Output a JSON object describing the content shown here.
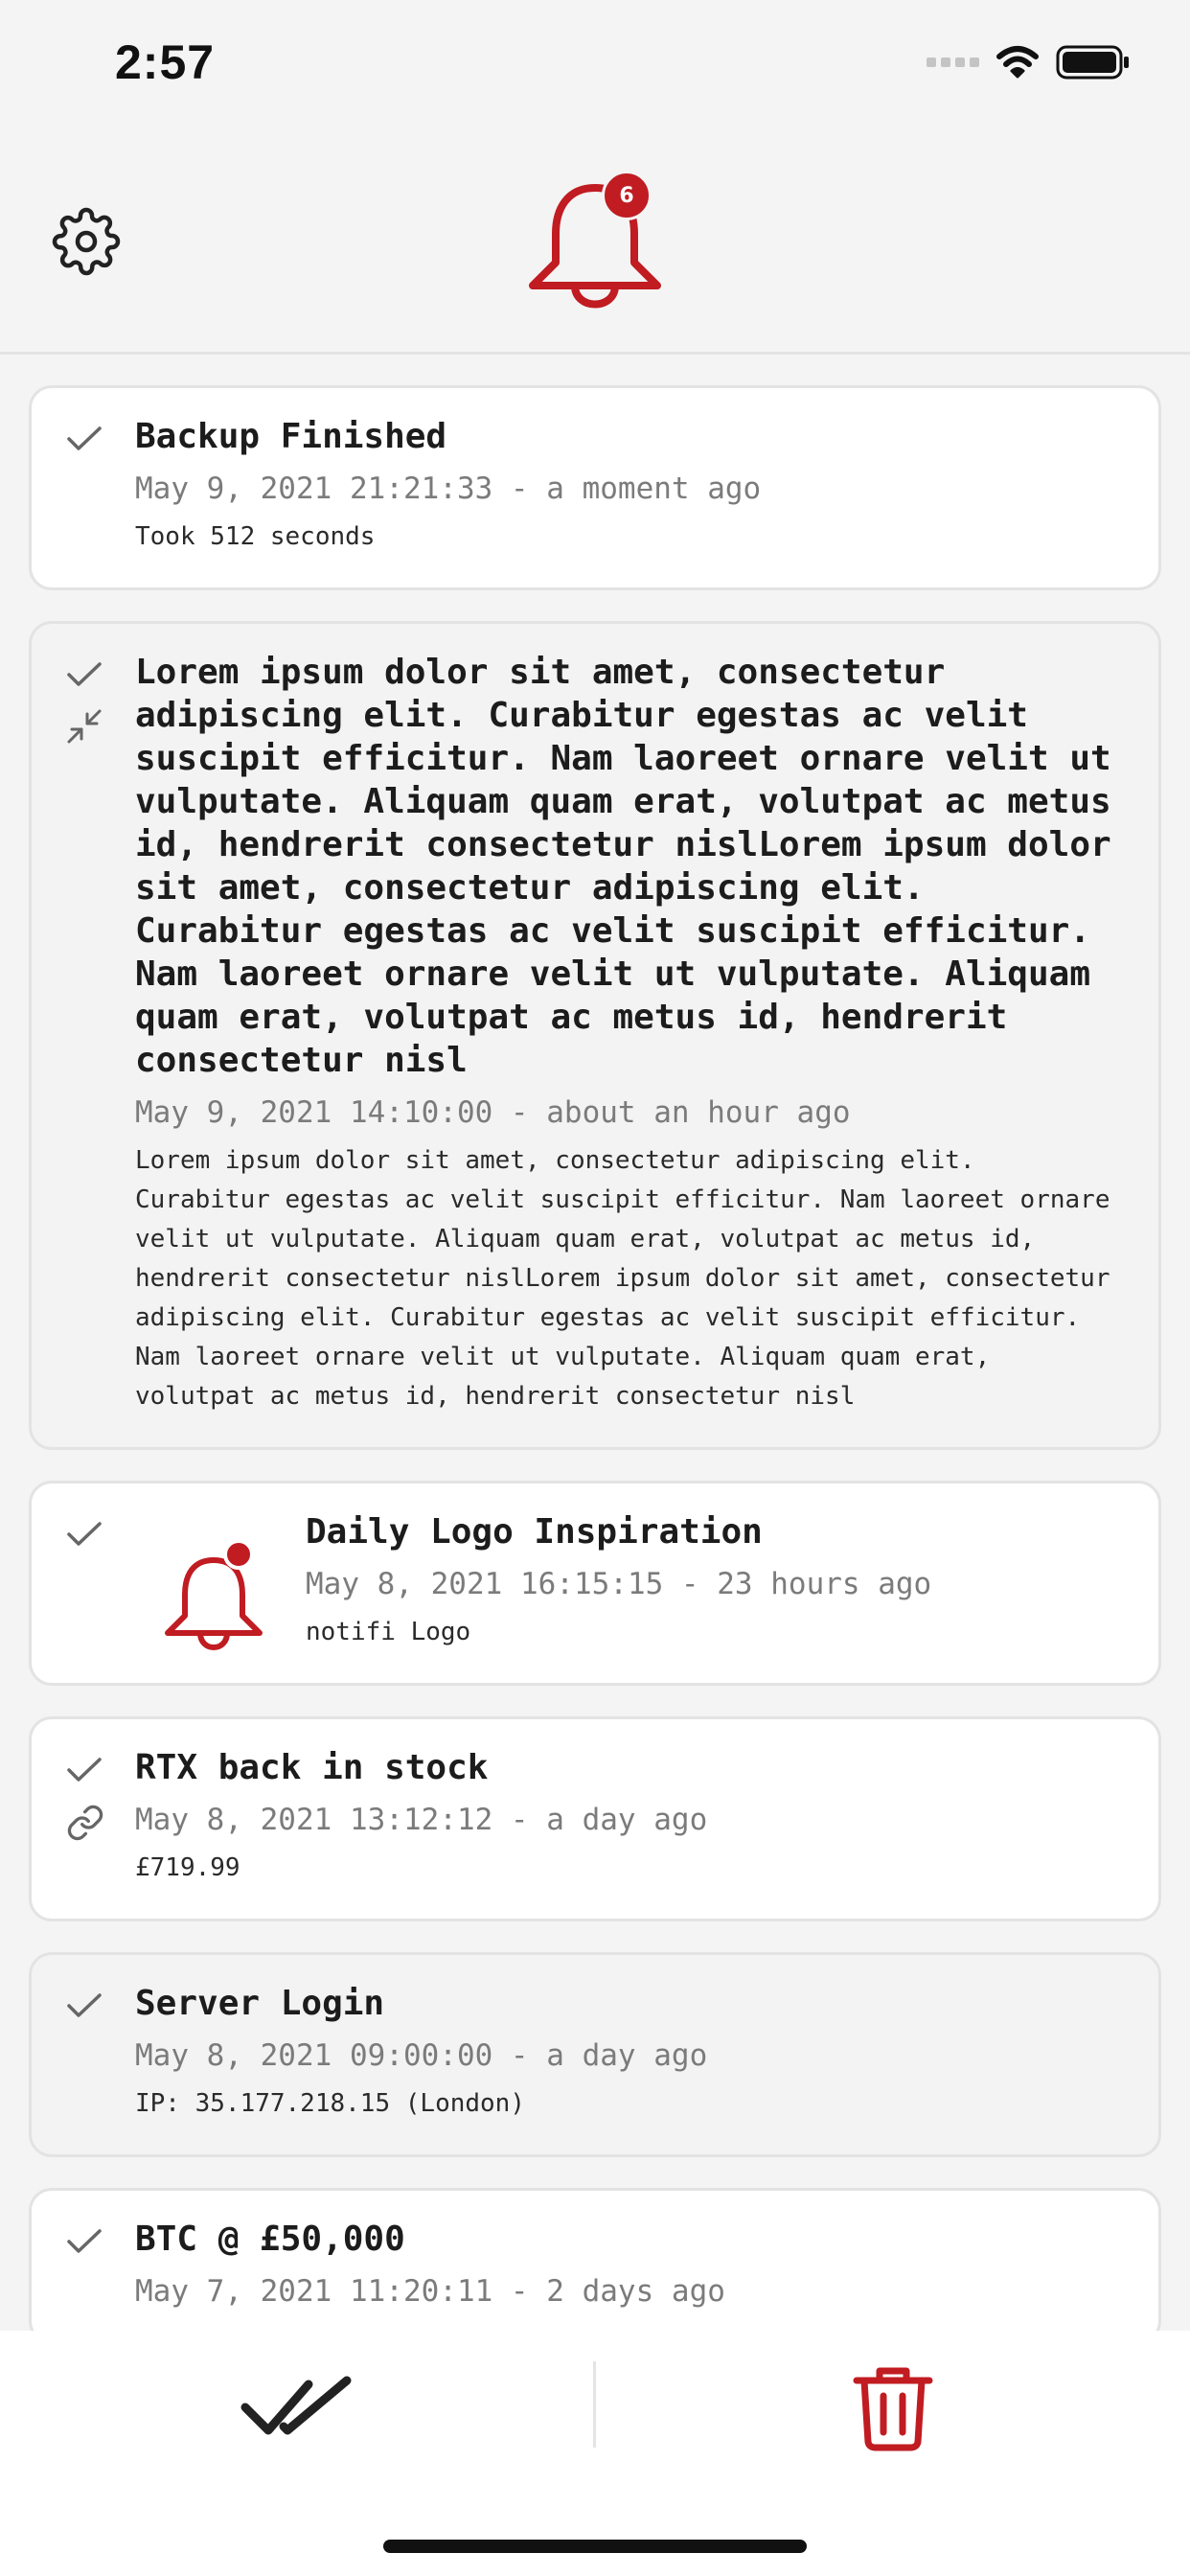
{
  "status_bar": {
    "time": "2:57"
  },
  "header": {
    "badge_count": "6",
    "accent_color": "#c01c22"
  },
  "notifications": [
    {
      "title": "Backup Finished",
      "meta": "May 9, 2021 21:21:33 - a moment ago",
      "body": "Took 512 seconds",
      "read": true
    },
    {
      "title": "Lorem ipsum dolor sit amet, consectetur adipiscing elit. Curabitur egestas ac velit suscipit efficitur. Nam laoreet ornare velit ut vulputate. Aliquam quam erat, volutpat ac metus id, hendrerit consectetur nislLorem ipsum dolor sit amet, consectetur adipiscing elit. Curabitur egestas ac velit suscipit efficitur. Nam laoreet ornare velit ut vulputate. Aliquam quam erat, volutpat ac metus id, hendrerit consectetur nisl",
      "meta": "May 9, 2021 14:10:00 - about an hour ago",
      "body": "Lorem ipsum dolor sit amet, consectetur adipiscing elit. Curabitur egestas ac velit suscipit efficitur. Nam laoreet ornare velit ut vulputate. Aliquam quam erat, volutpat ac metus id, hendrerit consectetur nislLorem ipsum dolor sit amet, consectetur adipiscing elit. Curabitur egestas ac velit suscipit efficitur. Nam laoreet ornare velit ut vulputate. Aliquam quam erat, volutpat ac metus id, hendrerit consectetur nisl",
      "read": true,
      "expanded": true
    },
    {
      "title": "Daily Logo Inspiration",
      "meta": "May 8, 2021 16:15:15 - 23 hours ago",
      "body": "notifi Logo",
      "read": true,
      "image": "bell-logo-icon"
    },
    {
      "title": "RTX back in stock",
      "meta": "May 8, 2021 13:12:12 - a day ago",
      "body": "£719.99",
      "read": true,
      "link": true
    },
    {
      "title": "Server Login",
      "meta": "May 8, 2021 09:00:00 - a day ago",
      "body": "IP: 35.177.218.15 (London)",
      "read": true
    },
    {
      "title": "BTC @ £50,000",
      "meta": "May 7, 2021 11:20:11 - 2 days ago",
      "read": true
    }
  ]
}
